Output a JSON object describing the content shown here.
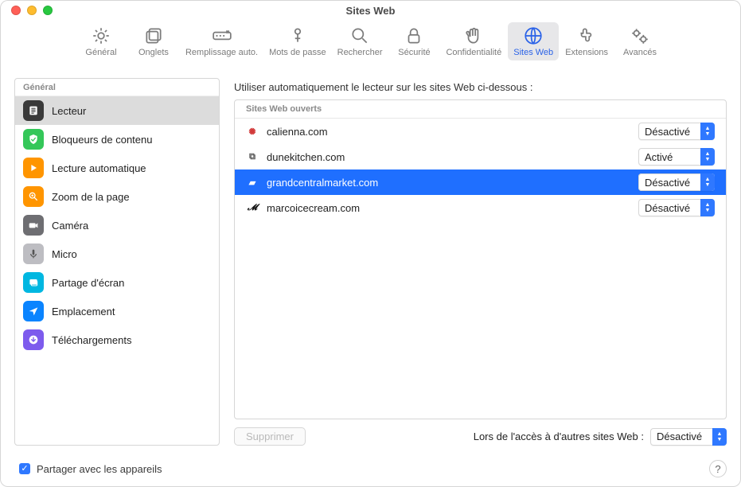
{
  "window": {
    "title": "Sites Web"
  },
  "toolbar": [
    {
      "id": "general",
      "label": "Général"
    },
    {
      "id": "tabs",
      "label": "Onglets"
    },
    {
      "id": "autofill",
      "label": "Remplissage auto."
    },
    {
      "id": "passwords",
      "label": "Mots de passe"
    },
    {
      "id": "search",
      "label": "Rechercher"
    },
    {
      "id": "security",
      "label": "Sécurité"
    },
    {
      "id": "privacy",
      "label": "Confidentialité"
    },
    {
      "id": "websites",
      "label": "Sites Web",
      "selected": true
    },
    {
      "id": "extensions",
      "label": "Extensions"
    },
    {
      "id": "advanced",
      "label": "Avancés"
    }
  ],
  "sidebar": {
    "section": "Général",
    "items": [
      {
        "id": "reader",
        "label": "Lecteur",
        "color": "#3a3a3a",
        "icon": "reader",
        "active": true
      },
      {
        "id": "adblock",
        "label": "Bloqueurs de contenu",
        "color": "#34c759",
        "icon": "shield"
      },
      {
        "id": "autoplay",
        "label": "Lecture automatique",
        "color": "#ff9500",
        "icon": "play"
      },
      {
        "id": "zoom",
        "label": "Zoom de la page",
        "color": "#ff9500",
        "icon": "zoom"
      },
      {
        "id": "camera",
        "label": "Caméra",
        "color": "#6e6e72",
        "icon": "camera"
      },
      {
        "id": "mic",
        "label": "Micro",
        "color": "#bdbdc2",
        "icon": "mic"
      },
      {
        "id": "screen",
        "label": "Partage d'écran",
        "color": "#00b7e1",
        "icon": "screen"
      },
      {
        "id": "location",
        "label": "Emplacement",
        "color": "#0a84ff",
        "icon": "arrow"
      },
      {
        "id": "downloads",
        "label": "Téléchargements",
        "color": "#7d5bed",
        "icon": "download"
      }
    ]
  },
  "content": {
    "heading": "Utiliser automatiquement le lecteur sur les sites Web ci-dessous :",
    "openHeader": "Sites Web ouverts",
    "rows": [
      {
        "site": "calienna.com",
        "favicon": "✺",
        "color": "#d23a3a",
        "value": "Désactivé"
      },
      {
        "site": "dunekitchen.com",
        "favicon": "⧉",
        "color": "#555",
        "value": "Activé"
      },
      {
        "site": "grandcentralmarket.com",
        "favicon": "▰",
        "color": "#fff",
        "value": "Désactivé",
        "selected": true
      },
      {
        "site": "marcoicecream.com",
        "favicon": "𝓜",
        "color": "#111",
        "value": "Désactivé"
      }
    ],
    "remove": "Supprimer",
    "otherLabel": "Lors de l'accès à d'autres sites Web :",
    "otherValue": "Désactivé"
  },
  "share": {
    "label": "Partager avec les appareils",
    "checked": true
  }
}
